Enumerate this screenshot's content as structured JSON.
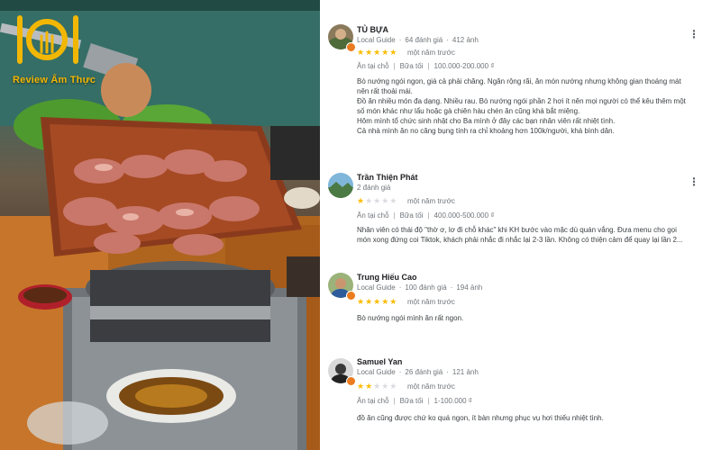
{
  "logo": {
    "text": "Review Ẩm Thực"
  },
  "reviews": [
    {
      "name": "TỦ BỰA",
      "badge": "Local Guide",
      "review_count": "64 đánh giá",
      "photo_count": "412 ảnh",
      "rating": 5,
      "time": "một năm trước",
      "tags": [
        "Ăn tại chỗ",
        "Bữa tối",
        "100.000-200.000 ₫"
      ],
      "body": [
        "Bò nướng ngói ngon, giá cả phải chăng. Ngăn rộng rãi, ăn món nướng nhưng không gian thoáng mát",
        "nên rất thoải mái.",
        "Đồ ăn nhiều món đa dạng. Nhiều rau. Bò nướng ngói phần 2 hơi ít nên mọi người có thể kêu thêm một",
        "số món khác như lẩu hoặc gà chiên hàu chén ăn cũng khá bắt miệng.",
        "Hôm mình tổ chức sinh nhật cho Ba mình ở đây các bạn nhân viên rất nhiệt tình.",
        "Cả nhà mình ăn no căng bụng tính ra chỉ khoảng hơn 100k/người, khá bình dân."
      ]
    },
    {
      "name": "Trần Thiện Phát",
      "badge": "",
      "review_count": "2 đánh giá",
      "photo_count": "",
      "rating": 1,
      "time": "một năm trước",
      "tags": [
        "Ăn tại chỗ",
        "Bữa tối",
        "400.000-500.000 ₫"
      ],
      "body": [
        "Nhân viên có thái độ \"thờ ơ, lơ đi chỗ khác\" khi KH bước vào mặc dù quán vắng. Đưa menu cho gọi",
        "món xong đứng coi Tiktok, khách phải nhắc đi nhắc lại 2-3 lần. Không có thiện cảm để quay lại lần 2..."
      ]
    },
    {
      "name": "Trung Hiếu Cao",
      "badge": "Local Guide",
      "review_count": "100 đánh giá",
      "photo_count": "194 ảnh",
      "rating": 5,
      "time": "một năm trước",
      "tags": [],
      "body": [
        "Bò nướng ngói mình ăn rất ngon."
      ]
    },
    {
      "name": "Samuel Yan",
      "badge": "Local Guide",
      "review_count": "26 đánh giá",
      "photo_count": "121 ảnh",
      "rating": 2,
      "time": "một năm trước",
      "tags": [
        "Ăn tại chỗ",
        "Bữa tối",
        "1-100.000 ₫"
      ],
      "body": [
        "đồ ăn cũng được chứ ko quá ngon, ít bàn nhưng phục vụ hơi thiếu nhiệt tình."
      ]
    }
  ],
  "icons": {
    "more": "more-vert-icon",
    "star": "star-icon",
    "guide": "local-guide-badge-icon"
  },
  "colors": {
    "star": "#fbbc04",
    "star_empty": "#dadce0",
    "logo": "#f2b705",
    "guide_badge": "#ea7b1f"
  }
}
